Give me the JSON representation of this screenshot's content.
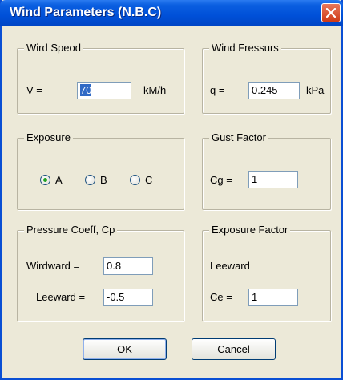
{
  "window": {
    "title": "Wind Parameters (N.B.C)"
  },
  "wind_speed": {
    "legend": "Wird Speod",
    "label": "V =",
    "value": "70",
    "unit": "kM/h"
  },
  "wind_pressure": {
    "legend": "Wind Fressurs",
    "label": "q =",
    "value": "0.245",
    "unit": "kPa"
  },
  "exposure": {
    "legend": "Exposure",
    "options": [
      "A",
      "B",
      "C"
    ],
    "selected": "A"
  },
  "gust_factor": {
    "legend": "Gust Factor",
    "label": "Cg =",
    "value": "1"
  },
  "pressure_coeff": {
    "legend": "Pressure Coeff, Cp",
    "windward_label": "Wirdward =",
    "windward_value": "0.8",
    "leeward_label": "Leeward =",
    "leeward_value": "-0.5"
  },
  "exposure_factor": {
    "legend": "Exposure Factor",
    "sublabel": "Leeward",
    "label": "Ce =",
    "value": "1"
  },
  "buttons": {
    "ok": "OK",
    "cancel": "Cancel"
  }
}
